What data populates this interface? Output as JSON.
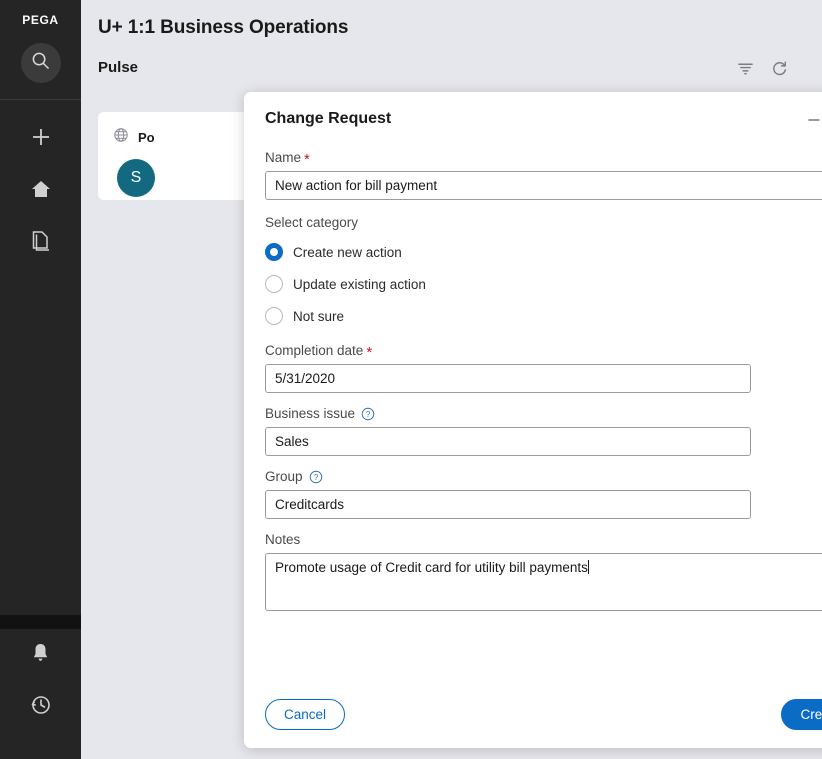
{
  "sidebar": {
    "brand": "PEGA",
    "items": [
      {
        "name": "search-icon",
        "label": "Search"
      },
      {
        "name": "plus-icon",
        "label": "Create"
      },
      {
        "name": "home-icon",
        "label": "Home"
      },
      {
        "name": "documents-icon",
        "label": "Documents"
      }
    ],
    "bottom_items": [
      {
        "name": "bell-icon",
        "label": "Notifications"
      },
      {
        "name": "history-clock-icon",
        "label": "Recents"
      }
    ]
  },
  "header": {
    "title": "U+ 1:1 Business Operations",
    "section": "Pulse",
    "tools": [
      {
        "name": "filter-icon",
        "label": "Filter"
      },
      {
        "name": "refresh-icon",
        "label": "Refresh"
      }
    ]
  },
  "background_card": {
    "globe_icon": "globe-icon",
    "title": "Po",
    "avatar_initial": "S"
  },
  "modal": {
    "title": "Change Request",
    "minimize_label": "–",
    "close_label": "×",
    "name": {
      "label": "Name",
      "required": true,
      "value": "New action for bill payment",
      "placeholder": ""
    },
    "category": {
      "label": "Select category",
      "selected": "Create new action",
      "options": [
        {
          "label": "Create new action",
          "selected": true
        },
        {
          "label": "Update existing action",
          "selected": false
        },
        {
          "label": "Not sure",
          "selected": false
        }
      ]
    },
    "completion_date": {
      "label": "Completion date",
      "required": true,
      "value": "5/31/2020",
      "icon": "calendar-icon"
    },
    "business_issue": {
      "label": "Business issue",
      "help_icon": "help-circle-icon",
      "value": "Sales",
      "options": [
        "Sales"
      ]
    },
    "group": {
      "label": "Group",
      "help_icon": "help-circle-icon",
      "value": "Creditcards",
      "options": [
        "Creditcards"
      ]
    },
    "notes": {
      "label": "Notes",
      "value": "Promote usage of Credit card for utility bill payments",
      "placeholder": ""
    },
    "footer": {
      "cancel_label": "Cancel",
      "create_label": "Create"
    }
  },
  "colors": {
    "accent_blue": "#0a6cc4",
    "required_red": "#c8102e",
    "avatar_teal": "#136a80",
    "page_bg": "#e6e7ec",
    "sidebar_bg": "#252525"
  }
}
